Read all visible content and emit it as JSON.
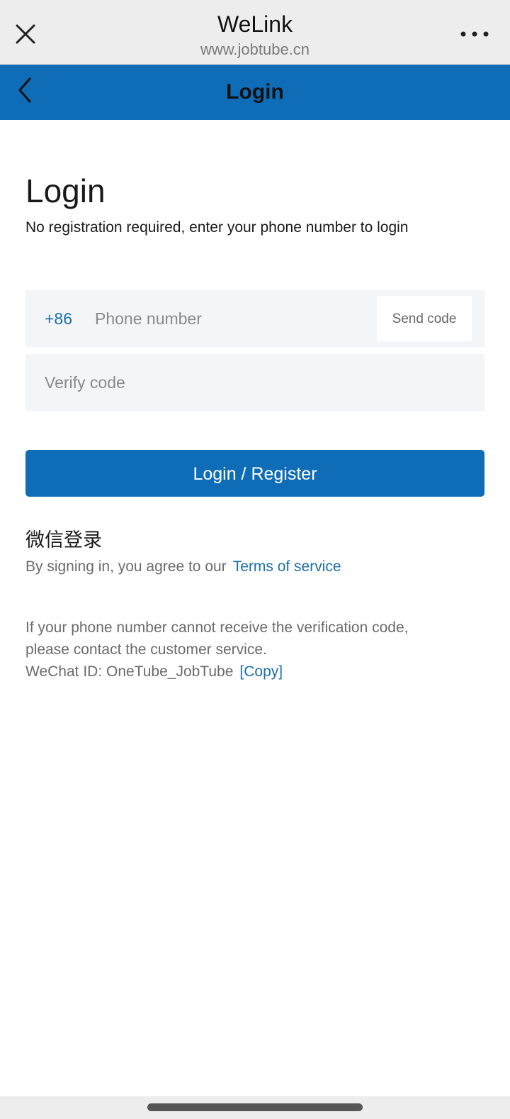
{
  "browser": {
    "title": "WeLink",
    "url": "www.jobtube.cn",
    "close_icon": "close-icon",
    "more_icon": "more-dots-icon"
  },
  "header": {
    "title": "Login",
    "back_icon": "chevron-left-icon"
  },
  "main": {
    "title": "Login",
    "subtitle": "No registration required, enter your phone number to login",
    "phone": {
      "country_code": "+86",
      "placeholder": "Phone number",
      "value": "",
      "send_code_label": "Send code"
    },
    "verify": {
      "placeholder": "Verify code",
      "value": ""
    },
    "login_button_label": "Login / Register",
    "wechat_login_label": "微信登录",
    "agree_text": "By signing in, you agree to our",
    "terms_link": "Terms of service",
    "help_line1": "If your phone number cannot receive the verification code,",
    "help_line2": "please contact the customer service.",
    "wechat_id_text": "WeChat ID: OneTube_JobTube",
    "copy_link": "[Copy]"
  },
  "colors": {
    "brand_blue": "#0f6db8",
    "link_blue": "#1c6fa8",
    "field_bg": "#f4f5f7",
    "browser_bar_bg": "#ededed"
  }
}
